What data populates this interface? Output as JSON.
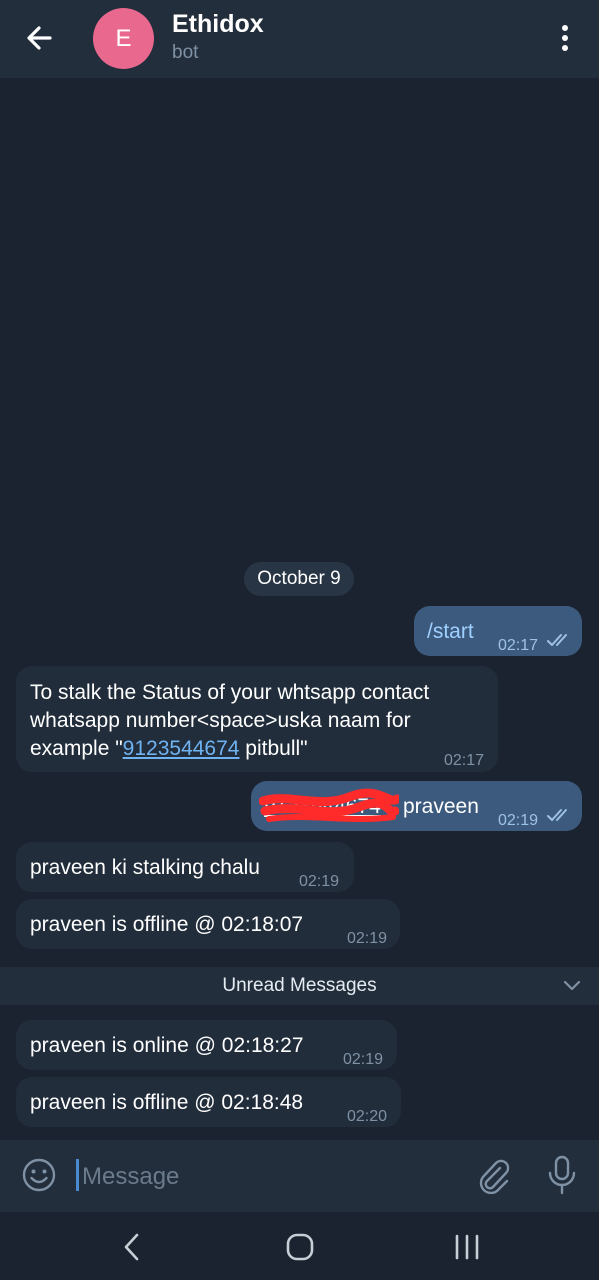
{
  "header": {
    "avatar_letter": "E",
    "avatar_color": "#e8688e",
    "title": "Ethidox",
    "subtitle": "bot",
    "back_icon": "arrow-left-icon",
    "menu_icon": "more-vertical-icon"
  },
  "chat": {
    "date": "October 9",
    "messages": [
      {
        "direction": "out",
        "text": "/start",
        "time": "02:17",
        "status": "read"
      },
      {
        "direction": "in",
        "line1": "To stalk the Status of your whtsapp contact",
        "line2": "whatsapp number<space>uska naam for",
        "line3_prefix": "example \"",
        "line3_link": "9123544674",
        "line3_suffix": " pitbull\"",
        "time": "02:17"
      },
      {
        "direction": "out",
        "redacted_prefix": "9123544674",
        "text": "praveen",
        "time": "02:19",
        "status": "read"
      },
      {
        "direction": "in",
        "text": "praveen ki stalking chalu",
        "time": "02:19"
      },
      {
        "direction": "in",
        "text": "praveen is offline @ 02:18:07",
        "time": "02:19"
      },
      {
        "direction": "in",
        "text": "praveen is online @ 02:18:27",
        "time": "02:19"
      },
      {
        "direction": "in",
        "text": "praveen is offline @ 02:18:48",
        "time": "02:20"
      }
    ],
    "unread_label": "Unread Messages"
  },
  "input": {
    "placeholder": "Message",
    "value": "",
    "emoji_icon": "emoji-icon",
    "attach_icon": "paperclip-icon",
    "mic_icon": "microphone-icon"
  },
  "navigation": {
    "back_icon": "nav-back-icon",
    "home_icon": "nav-home-icon",
    "recent_icon": "nav-recent-apps-icon"
  },
  "colors": {
    "background": "#1b2230",
    "header": "#232e3c",
    "incoming_bubble": "#222d3b",
    "outgoing_bubble": "#3c5a7e",
    "link": "#6fb3f2",
    "redaction": "#ff2a2a"
  }
}
